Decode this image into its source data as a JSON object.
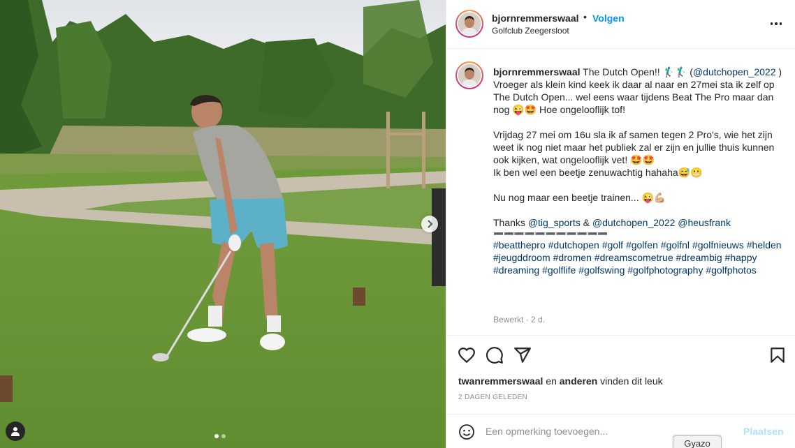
{
  "post": {
    "username": "bjornremmerswaal",
    "separator": "•",
    "follow_label": "Volgen",
    "location": "Golfclub Zeegersloot",
    "caption": {
      "username": "bjornremmerswaal",
      "title_text": "The Dutch Open!! 🏌️‍♂️🏌️‍♂️ (",
      "title_mention": "@dutchopen_2022",
      "title_end": ")",
      "para1": "Vroeger als klein kind keek ik daar al naar en 27mei sta ik zelf op The Dutch Open... wel eens waar tijdens Beat The Pro maar dan nog 😜🤩 Hoe ongelooflijk tof!",
      "para2": "Vrijdag 27 mei om 16u sla ik af samen tegen 2 Pro's, wie het zijn weet ik nog niet maar het publiek zal er zijn en jullie thuis kunnen ook kijken, wat ongelooflijk vet! 🤩🤩",
      "para2b": "Ik ben wel een beetje zenuwachtig hahaha😅😬",
      "para3": "Nu nog maar een beetje trainen... 😜💪🏼",
      "thanks_prefix": "Thanks ",
      "mention_1": "@tig_sports",
      "amp": " & ",
      "mention_2": "@dutchopen_2022",
      "mention_3": "@heusfrank",
      "divider": "➖➖➖➖➖➖➖➖➖➖➖",
      "hashtags": [
        "#beatthepro",
        "#dutchopen",
        "#golf",
        "#golfen",
        "#golfnl",
        "#golfnieuws",
        "#helden",
        "#jeugddroom",
        "#dromen",
        "#dreamscometrue",
        "#dreambig",
        "#happy",
        "#dreaming",
        "#golflife",
        "#golfswing",
        "#golfphotography",
        "#golfphotos"
      ]
    },
    "edited_label": "Bewerkt",
    "edited_sep": "·",
    "edited_time": "2 d.",
    "likes": {
      "user": "twanremmerswaal",
      "and": " en ",
      "others": "anderen",
      "suffix": " vinden dit leuk"
    },
    "date": "2 DAGEN GELEDEN",
    "comment_placeholder": "Een opmerking toevoegen...",
    "post_label": "Plaatsen",
    "carousel": {
      "count": 2,
      "active": 0
    }
  },
  "overlay": {
    "gvazo_label": "Gyazo"
  },
  "icons": {
    "like": "heart-icon",
    "comment": "comment-icon",
    "share": "paper-plane-icon",
    "save": "bookmark-icon",
    "more": "more-icon",
    "emoji": "emoji-icon",
    "next": "chevron-right-icon",
    "tags": "user-tag-icon"
  },
  "colors": {
    "accent": "#0095f6",
    "link": "#00376b",
    "muted": "#8e8e8e",
    "post_disabled": "#b2dffc"
  }
}
